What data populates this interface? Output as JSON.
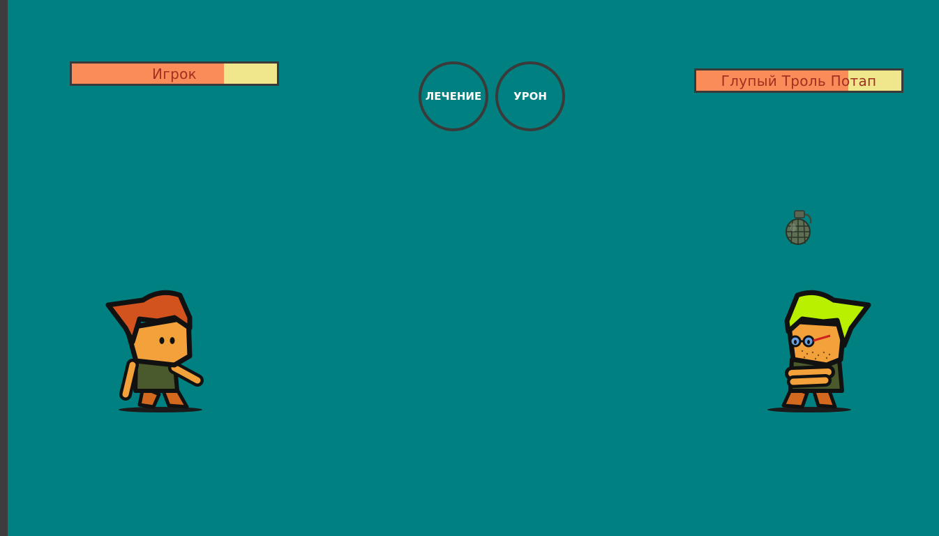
{
  "player": {
    "name": "Игрок",
    "hp_fraction": 0.74
  },
  "enemy": {
    "name": "Глупый Троль Потап",
    "hp_fraction": 0.74
  },
  "actions": {
    "heal_label": "ЛЕЧЕНИЕ",
    "damage_label": "УРОН"
  },
  "colors": {
    "background": "#008080",
    "hp_fill": "#f98c58",
    "hp_empty": "#f0e68c",
    "hp_border": "#3a3a3a",
    "name_text": "#a03020"
  },
  "icons": {
    "projectile": "grenade-icon"
  }
}
